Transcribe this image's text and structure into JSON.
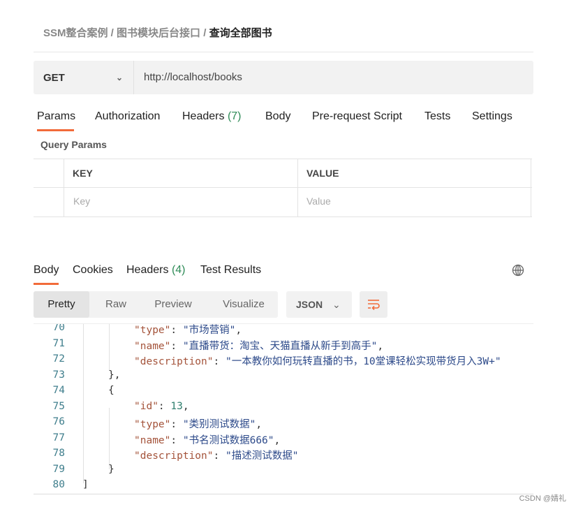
{
  "breadcrumb": [
    "SSM整合案例",
    "图书模块后台接口",
    "查询全部图书"
  ],
  "request": {
    "method": "GET",
    "url": "http://localhost/books"
  },
  "request_tabs": [
    {
      "label": "Params"
    },
    {
      "label": "Authorization"
    },
    {
      "label": "Headers",
      "count": "(7)"
    },
    {
      "label": "Body"
    },
    {
      "label": "Pre-request Script"
    },
    {
      "label": "Tests"
    },
    {
      "label": "Settings"
    }
  ],
  "query_params": {
    "title": "Query Params",
    "key_header": "KEY",
    "value_header": "VALUE",
    "key_placeholder": "Key",
    "value_placeholder": "Value"
  },
  "response_tabs": [
    {
      "label": "Body"
    },
    {
      "label": "Cookies"
    },
    {
      "label": "Headers",
      "count": "(4)"
    },
    {
      "label": "Test Results"
    }
  ],
  "view_buttons": [
    "Pretty",
    "Raw",
    "Preview",
    "Visualize"
  ],
  "format": "JSON",
  "accent": "#f26b3a",
  "code_lines": [
    {
      "n": "70",
      "indent": 2,
      "parts": [
        [
          "k",
          "\"type\""
        ],
        [
          "p",
          ": "
        ],
        [
          "s",
          "\"市场营销\""
        ],
        [
          "p",
          ","
        ]
      ]
    },
    {
      "n": "71",
      "indent": 2,
      "parts": [
        [
          "k",
          "\"name\""
        ],
        [
          "p",
          ": "
        ],
        [
          "s",
          "\"直播带货：淘宝、天猫直播从新手到高手\""
        ],
        [
          "p",
          ","
        ]
      ]
    },
    {
      "n": "72",
      "indent": 2,
      "parts": [
        [
          "k",
          "\"description\""
        ],
        [
          "p",
          ": "
        ],
        [
          "s",
          "\"一本教你如何玩转直播的书，10堂课轻松实现带货月入3W+\""
        ]
      ]
    },
    {
      "n": "73",
      "indent": 1,
      "parts": [
        [
          "p",
          "},"
        ]
      ]
    },
    {
      "n": "74",
      "indent": 1,
      "parts": [
        [
          "p",
          "{"
        ]
      ]
    },
    {
      "n": "75",
      "indent": 2,
      "parts": [
        [
          "k",
          "\"id\""
        ],
        [
          "p",
          ": "
        ],
        [
          "n",
          "13"
        ],
        [
          "p",
          ","
        ]
      ]
    },
    {
      "n": "76",
      "indent": 2,
      "parts": [
        [
          "k",
          "\"type\""
        ],
        [
          "p",
          ": "
        ],
        [
          "s",
          "\"类别测试数据\""
        ],
        [
          "p",
          ","
        ]
      ]
    },
    {
      "n": "77",
      "indent": 2,
      "parts": [
        [
          "k",
          "\"name\""
        ],
        [
          "p",
          ": "
        ],
        [
          "s",
          "\"书名测试数据666\""
        ],
        [
          "p",
          ","
        ]
      ]
    },
    {
      "n": "78",
      "indent": 2,
      "parts": [
        [
          "k",
          "\"description\""
        ],
        [
          "p",
          ": "
        ],
        [
          "s",
          "\"描述测试数据\""
        ]
      ]
    },
    {
      "n": "79",
      "indent": 1,
      "parts": [
        [
          "p",
          "}"
        ]
      ]
    },
    {
      "n": "80",
      "indent": 0,
      "parts": [
        [
          "p",
          "]"
        ]
      ]
    }
  ],
  "watermark": "CSDN @婧礼"
}
